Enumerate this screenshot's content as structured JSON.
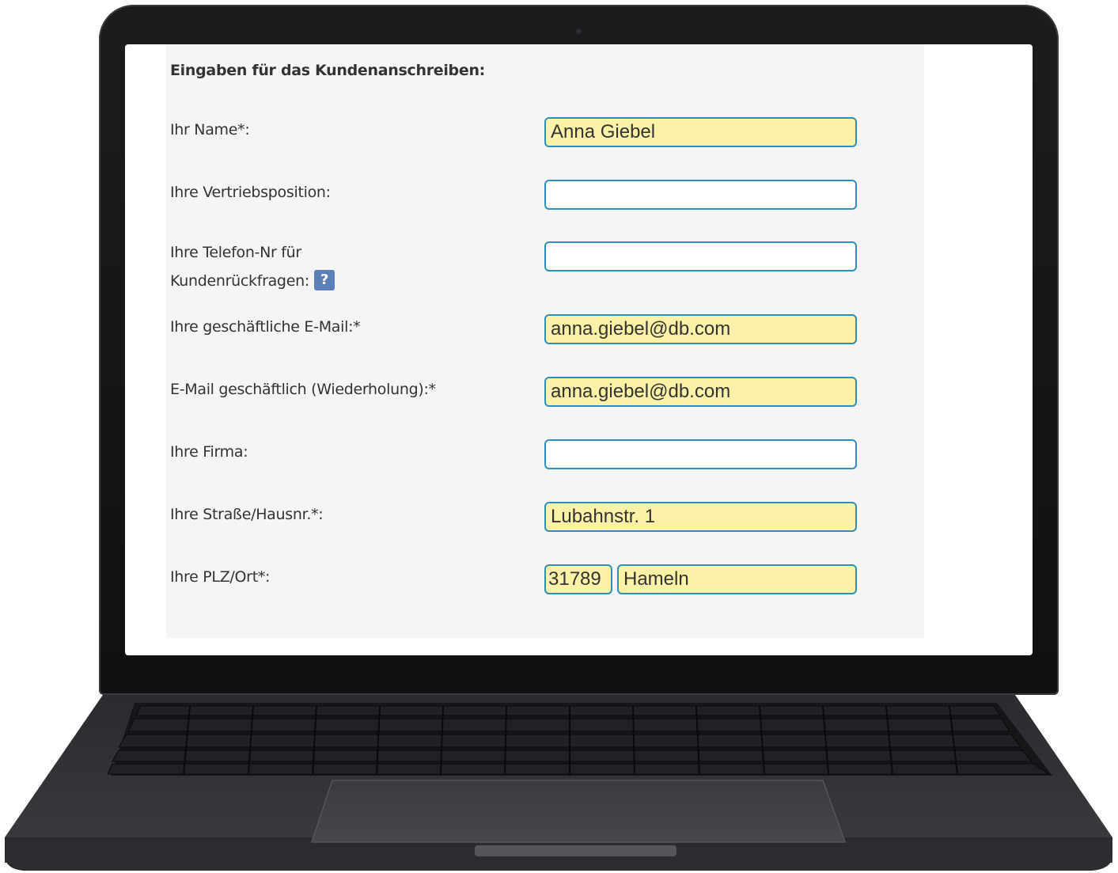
{
  "form": {
    "heading": "Eingaben für das Kundenanschreiben:",
    "fields": {
      "name": {
        "label": "Ihr Name*:",
        "value": "Anna Giebel"
      },
      "position": {
        "label": "Ihre Vertriebsposition:",
        "value": ""
      },
      "phone": {
        "label_line1": "Ihre Telefon-Nr für",
        "label_line2": "Kundenrückfragen:",
        "help_icon": "?",
        "value": ""
      },
      "email": {
        "label": "Ihre geschäftliche E-Mail:*",
        "value": "anna.giebel@db.com"
      },
      "email_repeat": {
        "label": "E-Mail geschäftlich (Wiederholung):*",
        "value": "anna.giebel@db.com"
      },
      "company": {
        "label": "Ihre Firma:",
        "value": ""
      },
      "street": {
        "label": "Ihre Straße/Hausnr.*:",
        "value": "Lubahnstr. 1"
      },
      "city": {
        "label": "Ihre PLZ/Ort*:",
        "zip": "31789",
        "city": "Hameln"
      }
    }
  },
  "colors": {
    "input_border": "#2f8fb8",
    "autofill_background": "#fbf2a8",
    "help_icon": "#5c7fb8",
    "panel": "#f5f5f5"
  }
}
